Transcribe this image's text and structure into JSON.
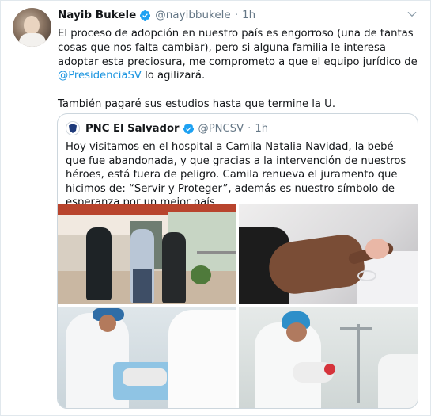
{
  "tweet": {
    "author_name": "Nayib Bukele",
    "author_handle": "@nayibbukele",
    "separator": "·",
    "time": "1h",
    "text_line1_a": "El proceso de adopción en nuestro país es engorroso (una de tantas cosas que nos falta cambiar), pero si alguna familia le interesa adoptar esta preciosura, me comprometo a que el equipo jurídico de ",
    "mention": "@PresidenciaSV",
    "text_line1_b": " lo agilizará.",
    "text_para2": "También pagaré sus estudios hasta que termine la U."
  },
  "quoted": {
    "author_name": "PNC El Salvador",
    "author_handle": "@PNCSV",
    "separator": "·",
    "time": "1h",
    "text": "Hoy visitamos en el hospital a Camila Natalia Navidad, la bebé que fue abandonada, y que gracias a la intervención de nuestros héroes, está fuera de peligro. Camila renueva el juramento que hicimos de: “Servir y Proteger”, además es nuestro símbolo de esperanza por un mejor país."
  },
  "icons": {
    "verified": "verified-badge-icon",
    "menu": "chevron-down-icon"
  },
  "colors": {
    "link": "#1b95e0",
    "secondary_text": "#657786",
    "border": "#ccd6dd"
  }
}
